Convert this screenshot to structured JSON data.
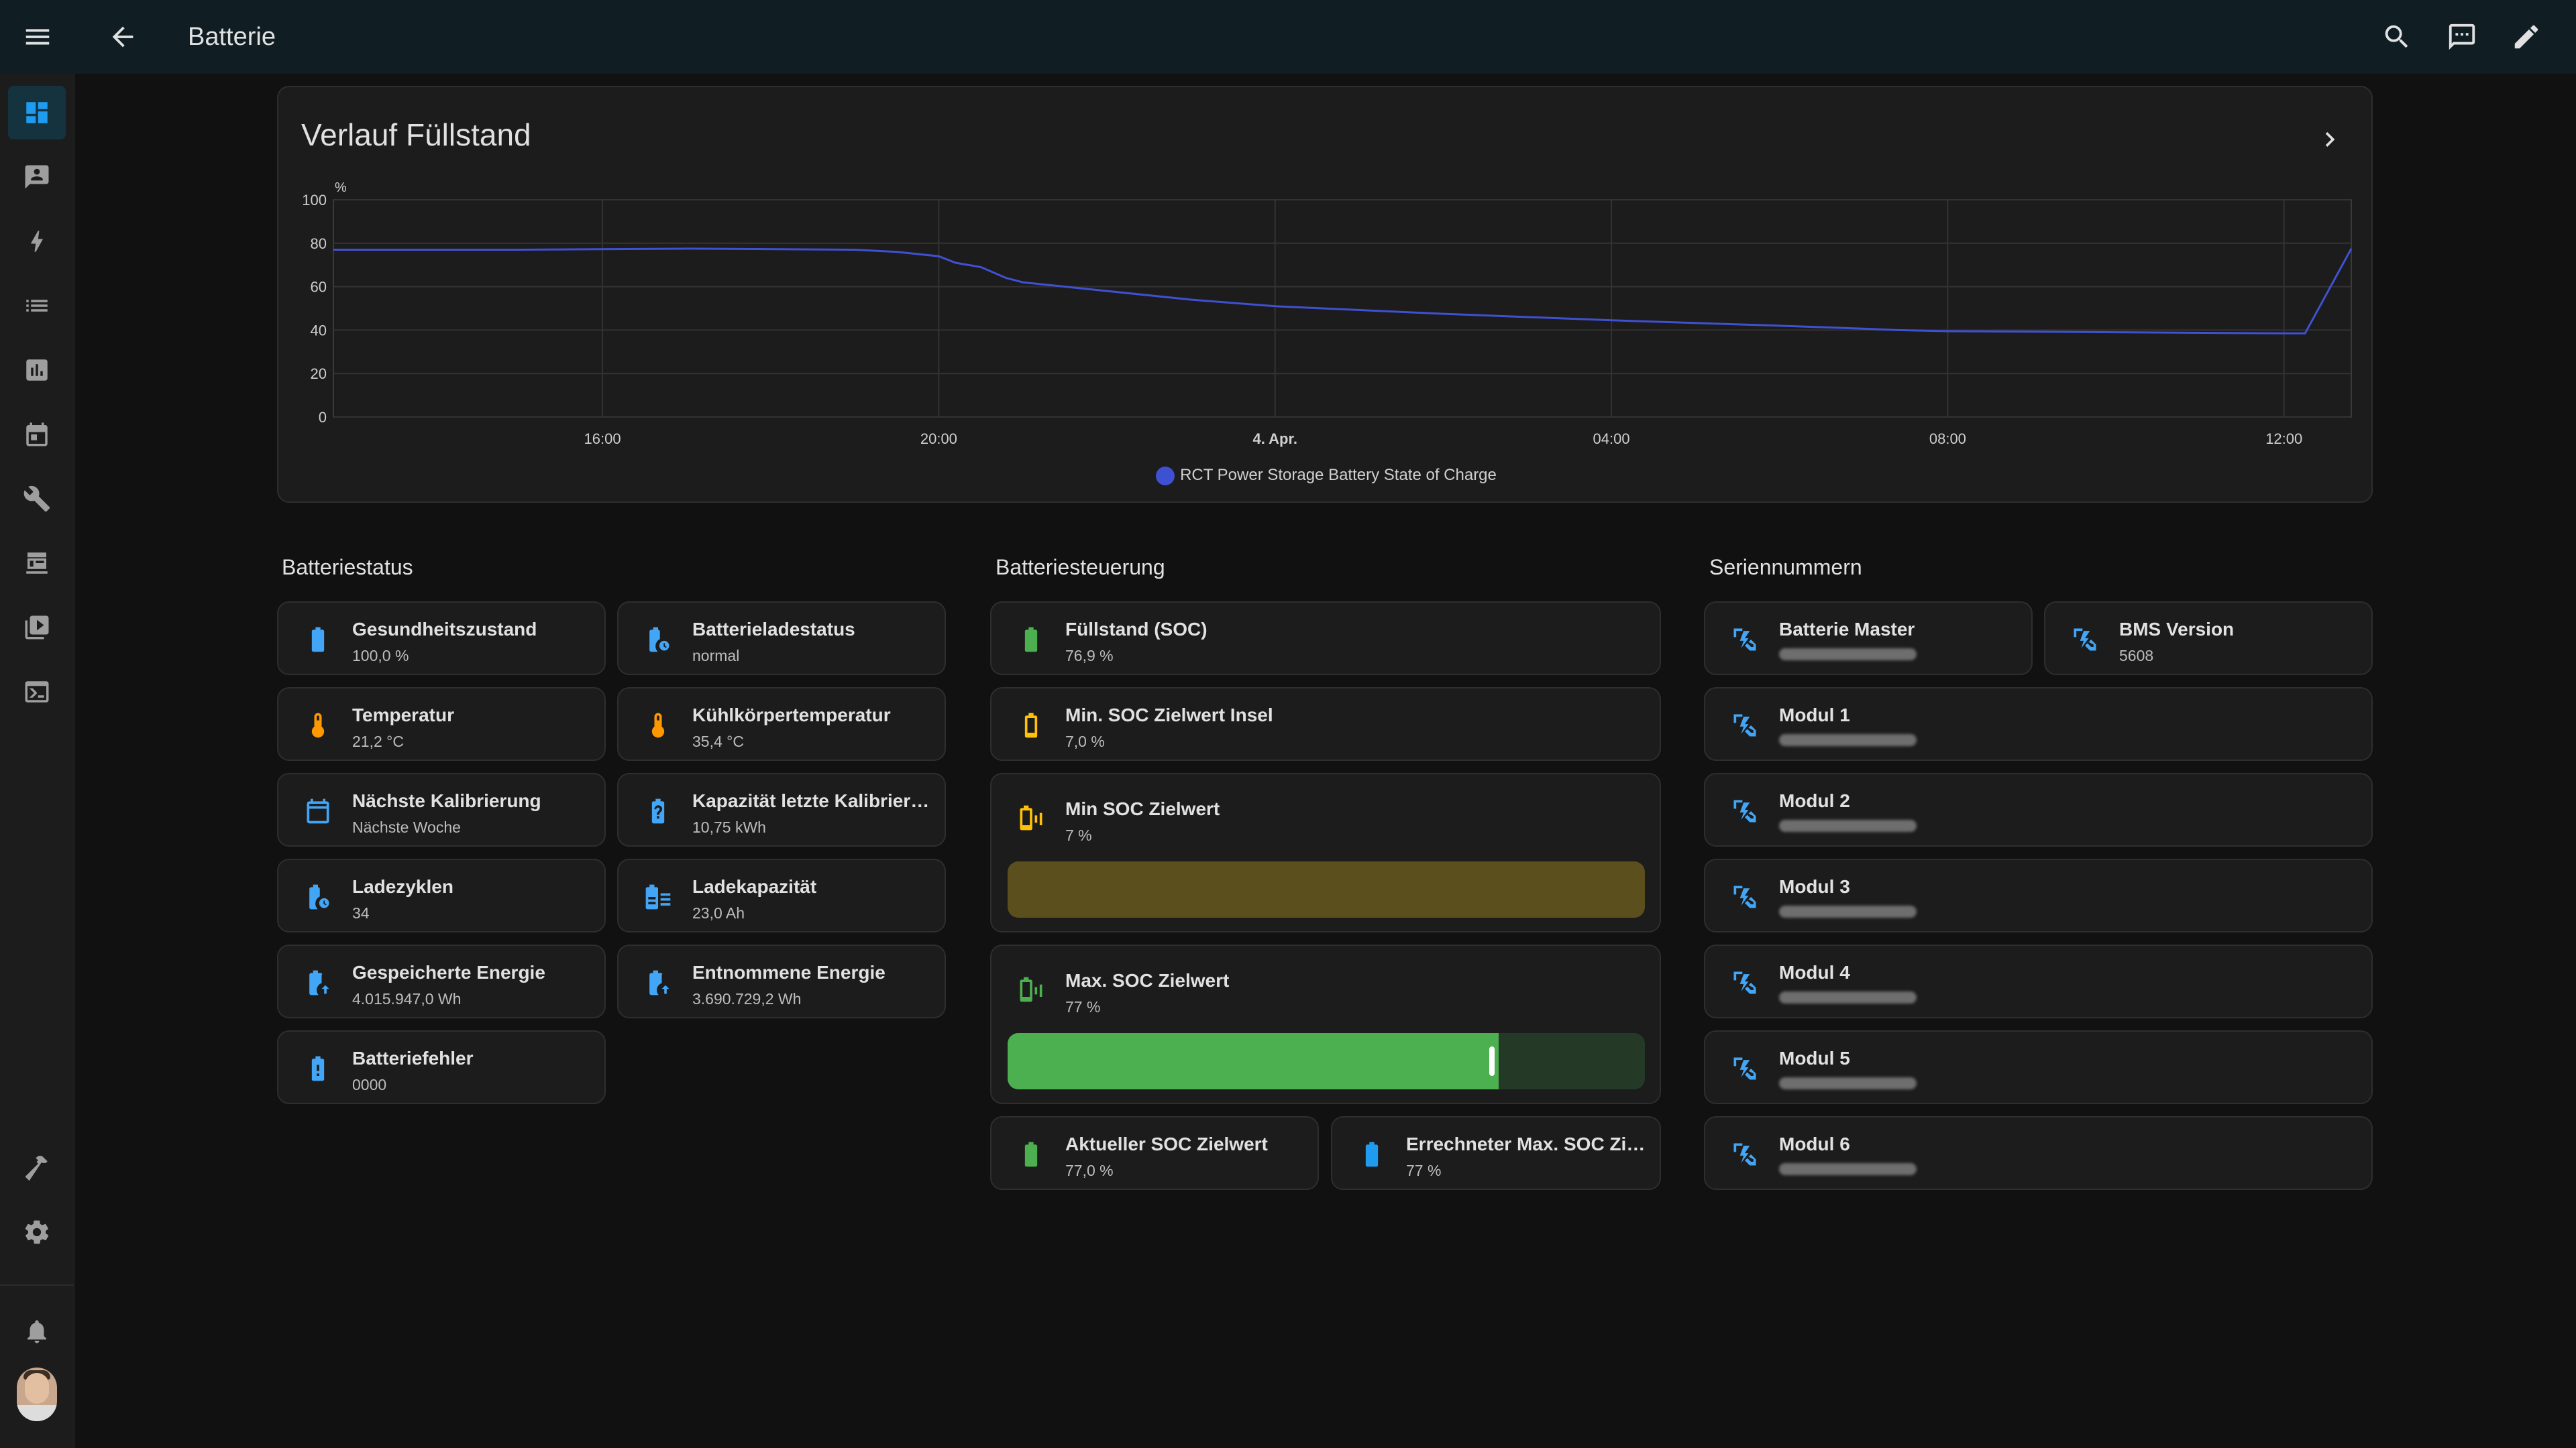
{
  "header": {
    "title": "Batterie"
  },
  "chart_card": {
    "title": "Verlauf Füllstand",
    "unit": "%",
    "legend": "RCT Power Storage Battery State of Charge"
  },
  "chart_data": {
    "type": "line",
    "title": "Verlauf Füllstand",
    "ylabel": "%",
    "ylim": [
      0,
      100
    ],
    "yticks": [
      0,
      20,
      40,
      60,
      80,
      100
    ],
    "xlim": [
      12.8,
      36.8
    ],
    "xticks": [
      {
        "x": 16,
        "label": "16:00"
      },
      {
        "x": 20,
        "label": "20:00"
      },
      {
        "x": 24,
        "label": "4. Apr."
      },
      {
        "x": 28,
        "label": "04:00"
      },
      {
        "x": 32,
        "label": "08:00"
      },
      {
        "x": 36,
        "label": "12:00"
      }
    ],
    "grid": true,
    "legend_position": "bottom",
    "series": [
      {
        "name": "RCT Power Storage Battery State of Charge",
        "color": "#3f51d3",
        "x": [
          12.8,
          15,
          17,
          19,
          19.5,
          20,
          20.2,
          20.5,
          20.8,
          21,
          22,
          23,
          24,
          26,
          28,
          30,
          31.1,
          31.4,
          32,
          34,
          36,
          36.25,
          36.8
        ],
        "y": [
          77,
          77,
          77.5,
          77,
          76,
          74,
          71,
          69,
          64,
          62,
          58,
          54,
          51,
          47.5,
          44.5,
          42,
          40.5,
          40,
          39.5,
          39,
          38.5,
          38.5,
          77.5
        ]
      }
    ]
  },
  "sections": {
    "status": {
      "title": "Batteriestatus",
      "tiles": [
        {
          "name": "Gesundheitszustand",
          "value": "100,0 %"
        },
        {
          "name": "Batterieladestatus",
          "value": "normal"
        },
        {
          "name": "Temperatur",
          "value": "21,2 °C"
        },
        {
          "name": "Kühlkörpertemperatur",
          "value": "35,4 °C"
        },
        {
          "name": "Nächste Kalibrierung",
          "value": "Nächste Woche"
        },
        {
          "name": "Kapazität letzte Kalibrieru...",
          "value": "10,75 kWh"
        },
        {
          "name": "Ladezyklen",
          "value": "34"
        },
        {
          "name": "Ladekapazität",
          "value": "23,0 Ah"
        },
        {
          "name": "Gespeicherte Energie",
          "value": "4.015.947,0 Wh"
        },
        {
          "name": "Entnommene Energie",
          "value": "3.690.729,2 Wh"
        },
        {
          "name": "Batteriefehler",
          "value": "0000"
        }
      ]
    },
    "control": {
      "title": "Batteriesteuerung",
      "tiles": [
        {
          "name": "Füllstand (SOC)",
          "value": "76,9 %"
        },
        {
          "name": "Min. SOC Zielwert Insel",
          "value": "7,0 %"
        },
        {
          "name": "Min SOC Zielwert",
          "value": "7 %",
          "slider_level": 0.07
        },
        {
          "name": "Max. SOC Zielwert",
          "value": "77 %",
          "slider_level": 0.77
        },
        {
          "name": "Aktueller SOC Zielwert",
          "value": "77,0 %"
        },
        {
          "name": "Errechneter Max. SOC Ziel...",
          "value": "77 %"
        }
      ]
    },
    "serials": {
      "title": "Seriennummern",
      "tiles": [
        {
          "name": "Batterie Master",
          "value": ""
        },
        {
          "name": "BMS Version",
          "value": "5608"
        },
        {
          "name": "Modul 1",
          "value": ""
        },
        {
          "name": "Modul 2",
          "value": ""
        },
        {
          "name": "Modul 3",
          "value": ""
        },
        {
          "name": "Modul 4",
          "value": ""
        },
        {
          "name": "Modul 5",
          "value": ""
        },
        {
          "name": "Modul 6",
          "value": ""
        }
      ]
    }
  },
  "colors": {
    "accent_blue": "#1f9cf0",
    "green": "#4caf50",
    "yellow": "#ffc107",
    "orange": "#ff9800",
    "icon_blue": "#42a5f5",
    "chart_line": "#3f51d3"
  },
  "icons": {
    "topbar": [
      "menu-icon",
      "back-arrow-icon",
      "search-icon",
      "assist-icon",
      "edit-pencil-icon"
    ],
    "sidebar": [
      "dashboard-icon",
      "map-icon",
      "energy-icon",
      "logbook-icon",
      "history-icon",
      "calendar-icon",
      "tools-icon",
      "hacs-icon",
      "media-icon",
      "terminal-icon",
      "developer-tools-icon",
      "settings-icon",
      "notifications-icon"
    ]
  }
}
